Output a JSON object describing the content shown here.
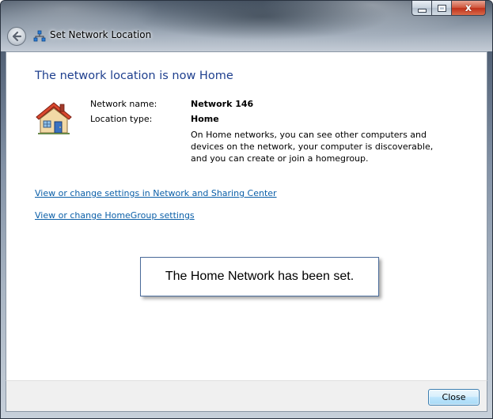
{
  "window": {
    "title": "Set Network Location",
    "caption_buttons": {
      "minimize_icon": "minimize-icon",
      "maximize_icon": "maximize-icon",
      "close_glyph": "x"
    },
    "back_icon": "back-arrow-icon"
  },
  "content": {
    "heading": "The network location is now Home",
    "house_icon": "house-icon",
    "network_name_label": "Network name:",
    "network_name_value": "Network  146",
    "location_type_label": "Location type:",
    "location_type_value": "Home",
    "description_lines": [
      "On Home networks, you can see other computers and",
      "devices on the network, your computer is discoverable,",
      "and you can create or join a homegroup."
    ],
    "links": [
      "View or change settings in Network and Sharing Center",
      "View or change HomeGroup settings"
    ],
    "callout": "The Home Network has been set."
  },
  "footer": {
    "close_label": "Close"
  },
  "colors": {
    "heading": "#1e3f8e",
    "link": "#0b5fa8",
    "callout_border": "#4a6b9a",
    "close_button_border": "#3c7fb1"
  }
}
